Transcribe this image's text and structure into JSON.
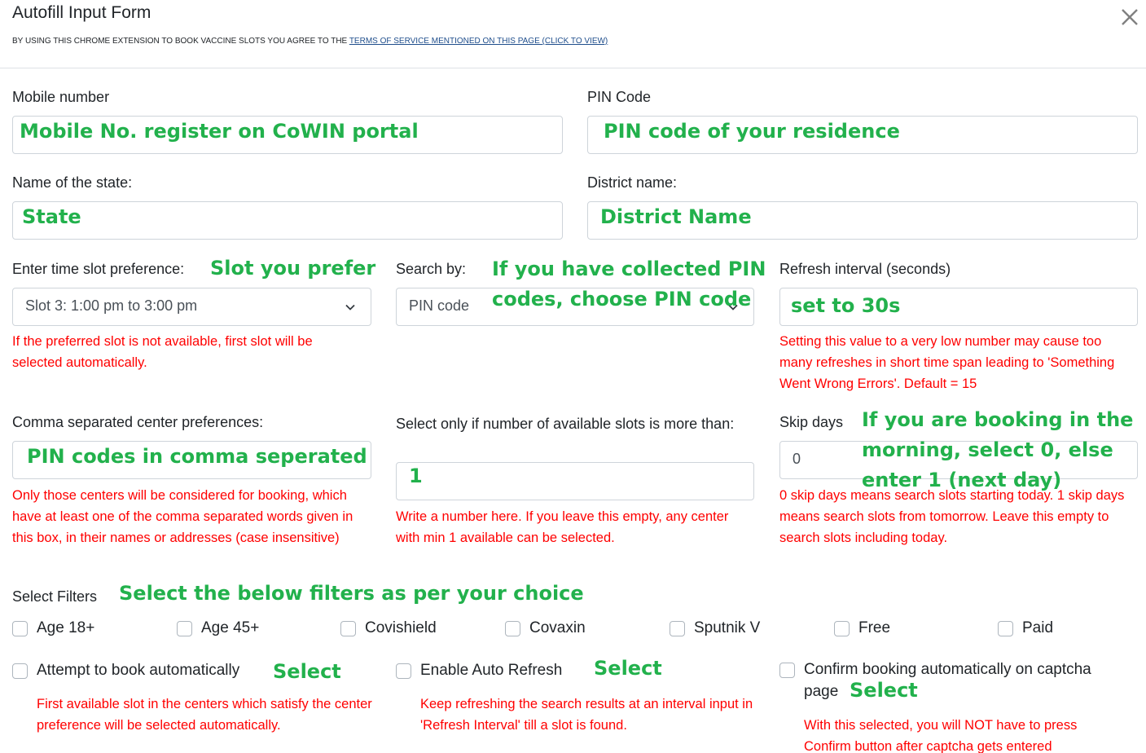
{
  "header": {
    "title": "Autofill Input Form",
    "terms_prefix": "BY USING THIS CHROME EXTENSION TO BOOK VACCINE SLOTS YOU AGREE TO THE ",
    "terms_link": "TERMS OF SERVICE MENTIONED ON THIS PAGE (Click to view)",
    "close_icon": "close-icon"
  },
  "colors": {
    "annotation_green": "#22b14c",
    "warning_red": "#ff0000",
    "link_blue": "#1f4e8c",
    "border": "#ced4da"
  },
  "fields": {
    "mobile": {
      "label": "Mobile number",
      "value": "Mobile No. register on CoWIN portal"
    },
    "pin": {
      "label": "PIN Code",
      "value": "PIN code of your residence"
    },
    "state": {
      "label": "Name of the state:",
      "value": "State"
    },
    "district": {
      "label": "District name:",
      "value": "District Name"
    },
    "slot": {
      "label": "Enter time slot preference:",
      "annotation": "Slot you prefer",
      "selected": "Slot 3: 1:00 pm to 3:00 pm",
      "help": "If the preferred slot is not available, first slot will be selected automatically."
    },
    "search_by": {
      "label": "Search by:",
      "selected": "PIN code",
      "annotation_line1": "If you have collected PIN",
      "annotation_line2": "codes, choose PIN code"
    },
    "refresh_interval": {
      "label": "Refresh interval (seconds)",
      "value": "set to 30s",
      "help": "Setting this value to a very low number may cause too many refreshes in short time span leading to 'Something Went Wrong Errors'. Default = 15"
    },
    "center_prefs": {
      "label": "Comma separated center preferences:",
      "value": "PIN codes in comma seperated",
      "help": "Only those centers will be considered for booking, which have at least one of the comma separated words given in this box, in their names or addresses (case insensitive)"
    },
    "min_slots": {
      "label": "Select only if number of available slots is more than:",
      "value": "1",
      "help": "Write a number here. If you leave this empty, any center with min 1 available can be selected."
    },
    "skip_days": {
      "label": "Skip days",
      "value": "0",
      "annotation_line1": "If you are booking in the",
      "annotation_line2": "morning, select 0, else",
      "annotation_line3": "enter 1 (next day)",
      "help": "0 skip days means search slots starting today. 1 skip days means search slots from tomorrow. Leave this empty to search slots including today."
    }
  },
  "filters": {
    "label": "Select Filters",
    "annotation": "Select the below filters as per your choice",
    "items": [
      {
        "label": "Age 18+",
        "checked": false
      },
      {
        "label": "Age 45+",
        "checked": false
      },
      {
        "label": "Covishield",
        "checked": false
      },
      {
        "label": "Covaxin",
        "checked": false
      },
      {
        "label": "Sputnik V",
        "checked": false
      },
      {
        "label": "Free",
        "checked": false
      },
      {
        "label": "Paid",
        "checked": false
      }
    ]
  },
  "options": {
    "auto_book": {
      "label": "Attempt to book automatically",
      "annotation": "Select",
      "checked": false,
      "help": "First available slot in the centers which satisfy the center preference will be selected automatically."
    },
    "auto_refresh": {
      "label": "Enable Auto Refresh",
      "annotation": "Select",
      "checked": false,
      "help": "Keep refreshing the search results at an interval input in 'Refresh Interval' till a slot is found."
    },
    "auto_confirm": {
      "label_line1": "Confirm booking automatically on captcha",
      "label_line2": "page",
      "annotation": "Select",
      "checked": false,
      "help": "With this selected, you will NOT have to press Confirm button after captcha gets entered"
    }
  }
}
